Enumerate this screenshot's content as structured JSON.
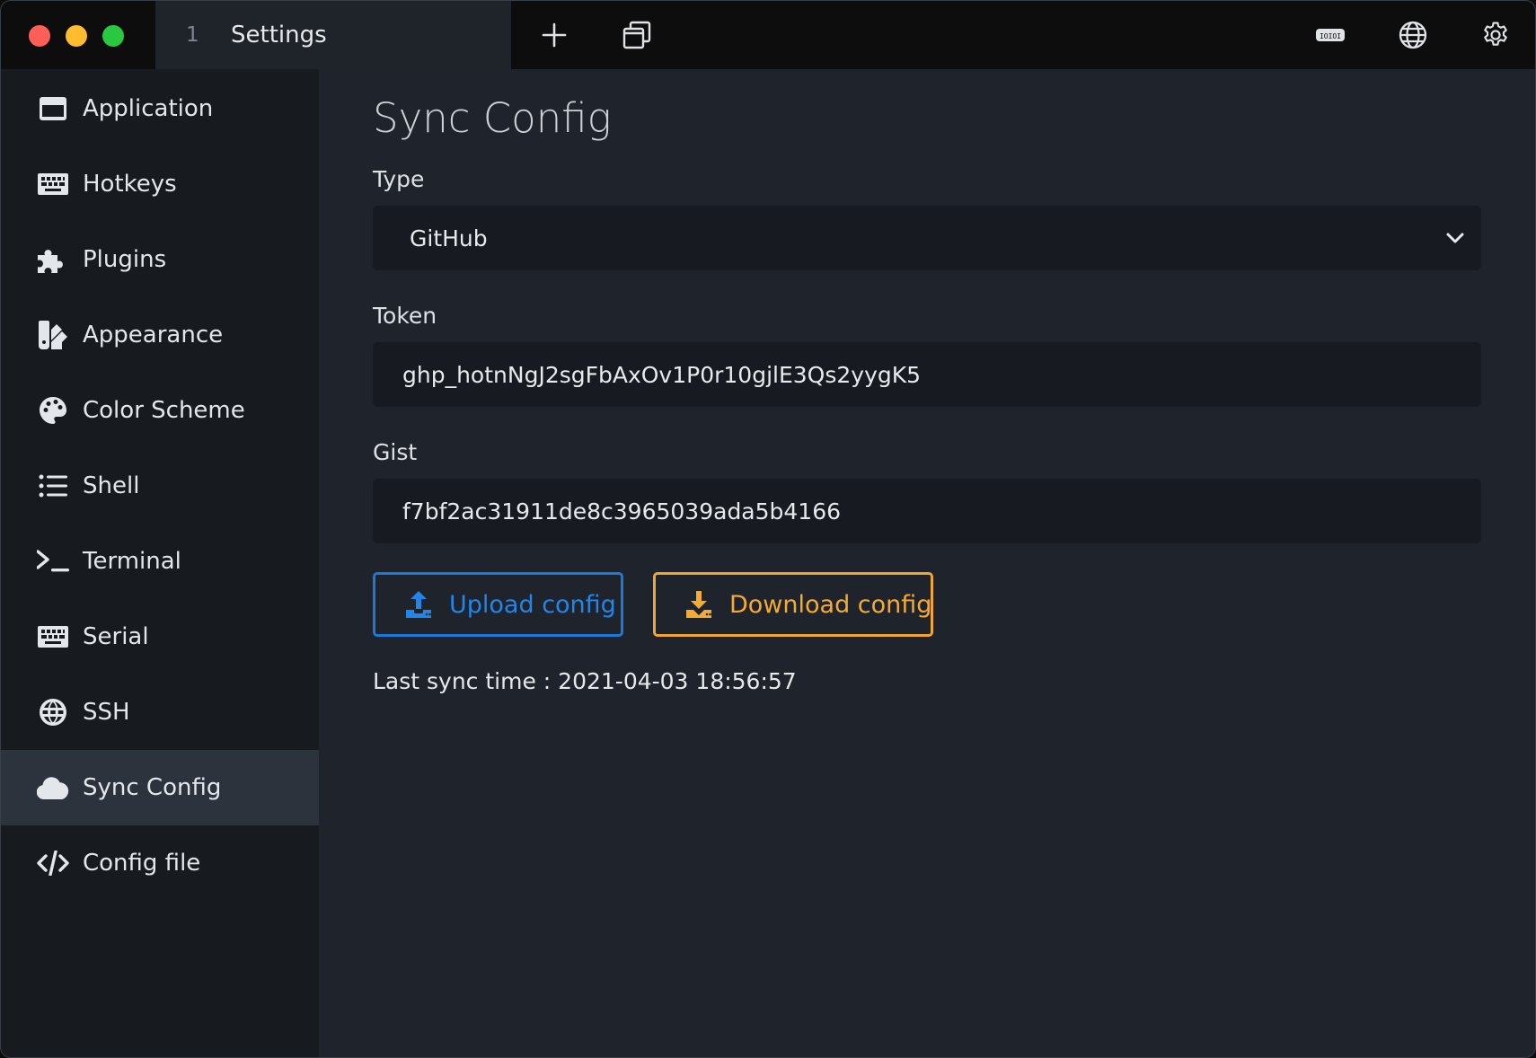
{
  "window": {
    "traffic_lights": [
      "close",
      "minimize",
      "zoom"
    ]
  },
  "tab": {
    "number": "1",
    "title": "Settings"
  },
  "toolbar": {
    "icons": [
      "plus-icon",
      "window-stack-icon",
      "serial-port-icon",
      "globe-icon",
      "gear-icon"
    ]
  },
  "sidebar": {
    "items": [
      {
        "label": "Application",
        "icon": "window-icon"
      },
      {
        "label": "Hotkeys",
        "icon": "keyboard-icon"
      },
      {
        "label": "Plugins",
        "icon": "puzzle-icon"
      },
      {
        "label": "Appearance",
        "icon": "swatchbook-icon"
      },
      {
        "label": "Color Scheme",
        "icon": "palette-icon"
      },
      {
        "label": "Shell",
        "icon": "list-icon"
      },
      {
        "label": "Terminal",
        "icon": "terminal-prompt-icon"
      },
      {
        "label": "Serial",
        "icon": "keyboard-icon"
      },
      {
        "label": "SSH",
        "icon": "globe-icon"
      },
      {
        "label": "Sync Config",
        "icon": "cloud-icon",
        "active": true
      },
      {
        "label": "Config file",
        "icon": "code-icon"
      }
    ]
  },
  "main": {
    "title": "Sync Config",
    "type": {
      "label": "Type",
      "value": "GitHub"
    },
    "token": {
      "label": "Token",
      "value": "ghp_hotnNgJ2sgFbAxOv1P0r10gjlE3Qs2yygK5"
    },
    "gist": {
      "label": "Gist",
      "value": "f7bf2ac31911de8c3965039ada5b4166"
    },
    "upload_label": "Upload config",
    "download_label": "Download config",
    "last_sync": "Last sync time : 2021-04-03 18:56:57"
  },
  "colors": {
    "upload_accent": "#1c79d8",
    "download_accent": "#f0a630",
    "active_sidebar": "#2d333c"
  }
}
